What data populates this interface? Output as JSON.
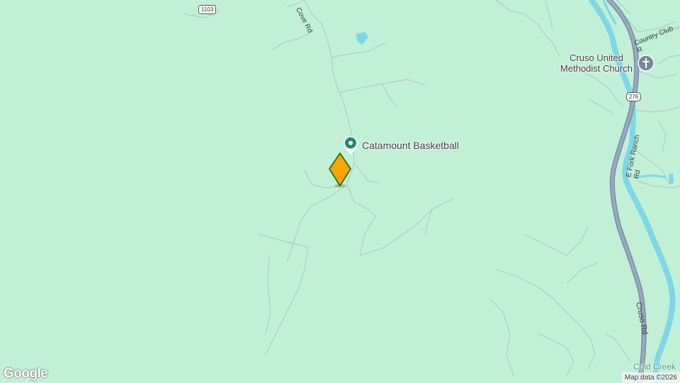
{
  "map": {
    "roads": {
      "cove_rd": "Cove Rd",
      "country_club": "Country Club R",
      "e_fork_ranch": "E Fork Ranch Rd",
      "cruso_rd": "Cruso Rd"
    },
    "shields": {
      "route_1103": "1103",
      "route_276": "276"
    },
    "pois": {
      "catamount": "Catamount Basketball",
      "church_line1": "Cruso United",
      "church_line2": "Methodist Church",
      "cold_creek": "Cold Creek"
    },
    "icons": {
      "poi_pin": "place-pin-icon",
      "church": "church-cross-icon",
      "marker": "selected-location-marker-icon"
    },
    "colors": {
      "land": "#c1f0d7",
      "river": "#7fd6e6",
      "highway": "#8a9bb3",
      "marker_fill": "#f7a600",
      "marker_stroke": "#2e6b1e",
      "poi_green": "#1e8a6e"
    },
    "branding": {
      "logo": "Google",
      "attribution": "Map data ©2026"
    }
  }
}
